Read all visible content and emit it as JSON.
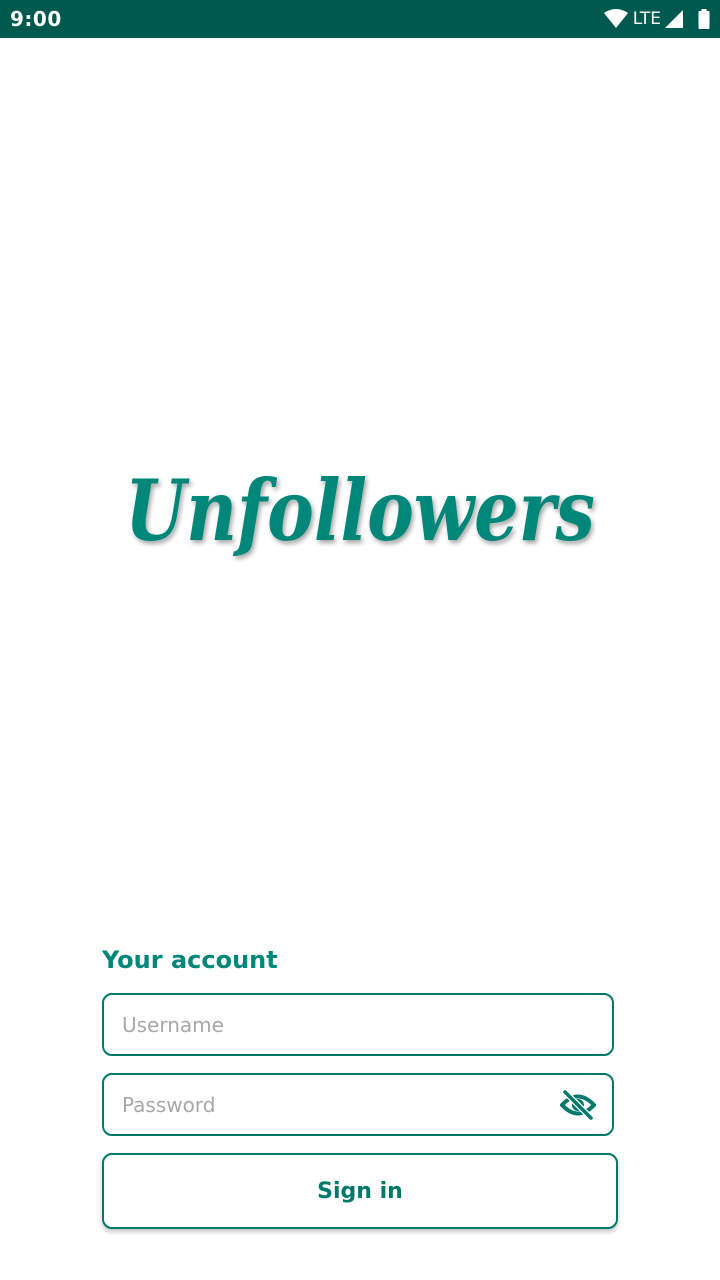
{
  "status_bar": {
    "time": "9:00",
    "network": "LTE",
    "icons": [
      "wifi-icon",
      "cellular-signal-icon",
      "battery-icon"
    ],
    "background_color": "#00594f"
  },
  "app": {
    "logo_text": "Unfollowers",
    "brand_color": "#00877a"
  },
  "login": {
    "heading": "Your account",
    "username": {
      "value": "",
      "placeholder": "Username"
    },
    "password": {
      "value": "",
      "placeholder": "Password",
      "visibility_icon": "eye-off-icon"
    },
    "sign_in_label": "Sign in"
  }
}
